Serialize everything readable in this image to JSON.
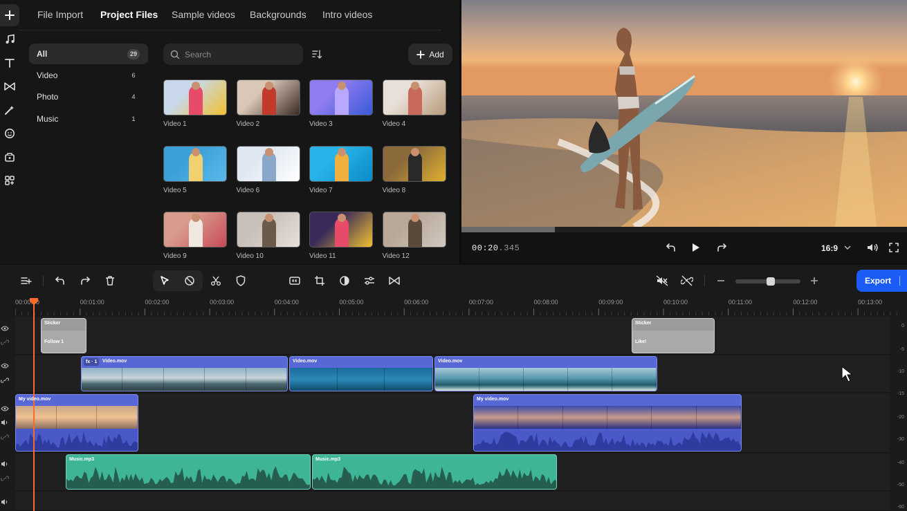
{
  "rail": [
    "plus-icon",
    "music-icon",
    "text-icon",
    "transition-icon",
    "effects-icon",
    "sticker-icon",
    "templates-icon",
    "apps-icon"
  ],
  "tabs": [
    {
      "label": "File Import",
      "active": false
    },
    {
      "label": "Project Files",
      "active": true
    },
    {
      "label": "Sample videos",
      "active": false
    },
    {
      "label": "Backgrounds",
      "active": false
    },
    {
      "label": "Intro videos",
      "active": false
    }
  ],
  "categories": [
    {
      "label": "All",
      "count": "29",
      "active": true
    },
    {
      "label": "Video",
      "count": "6",
      "active": false
    },
    {
      "label": "Photo",
      "count": "4",
      "active": false
    },
    {
      "label": "Music",
      "count": "1",
      "active": false
    }
  ],
  "search": {
    "placeholder": "Search"
  },
  "add_label": "Add",
  "media_items": [
    {
      "label": "Video 1",
      "colors": [
        "#c8d8ea",
        "#e84a6a",
        "#f0c030"
      ]
    },
    {
      "label": "Video 2",
      "colors": [
        "#d9c7b8",
        "#c43a2a",
        "#3b2a22"
      ]
    },
    {
      "label": "Video 3",
      "colors": [
        "#8e7cf0",
        "#b8a8ff",
        "#3a5ad8"
      ]
    },
    {
      "label": "Video 4",
      "colors": [
        "#e8e0d8",
        "#c86a5a",
        "#b89a7a"
      ]
    },
    {
      "label": "Video 5",
      "colors": [
        "#3aa0d8",
        "#f2d070",
        "#5ab8e8"
      ]
    },
    {
      "label": "Video 6",
      "colors": [
        "#dfe8f2",
        "#8aa6c8",
        "#ffffff"
      ]
    },
    {
      "label": "Video 7",
      "colors": [
        "#28b4e8",
        "#f0b040",
        "#0a8ac8"
      ]
    },
    {
      "label": "Video 8",
      "colors": [
        "#8a6a3a",
        "#2a2a2a",
        "#e0b030"
      ]
    },
    {
      "label": "Video 9",
      "colors": [
        "#d89a8a",
        "#f0e8e0",
        "#c84a5a"
      ]
    },
    {
      "label": "Video 10",
      "colors": [
        "#c8c0b8",
        "#6a5a4a",
        "#e8e0d8"
      ]
    },
    {
      "label": "Video 11",
      "colors": [
        "#3a2a5a",
        "#e84a6a",
        "#f0c030"
      ]
    },
    {
      "label": "Video 12",
      "colors": [
        "#b8a898",
        "#5a4a3a",
        "#d0c8c0"
      ]
    }
  ],
  "preview": {
    "time_main": "00:20",
    "time_ms": ".345",
    "ratio": "16:9",
    "progress": 0.21
  },
  "toolbar": {
    "export_label": "Export",
    "zoom_level": 0.55
  },
  "ruler": [
    "00:00:00",
    "00:01:00",
    "00:02:00",
    "00:03:00",
    "00:04:00",
    "00:05:00",
    "00:06:00",
    "00:07:00",
    "00:08:00",
    "00:09:00",
    "00:10:00",
    "00:11:00",
    "00:12:00",
    "00:13:00"
  ],
  "tracks": {
    "stickers": [
      {
        "title": "Sticker",
        "subtitle": "Follow 1"
      },
      {
        "title": "Sticker",
        "subtitle": "Like!"
      }
    ],
    "overlay_video": [
      {
        "name": "Video.mov",
        "fx": "fx · 1"
      },
      {
        "name": "Video.mov",
        "fx": ""
      },
      {
        "name": "Video.mov",
        "fx": ""
      }
    ],
    "main_video": [
      {
        "name": "My video.mov"
      },
      {
        "name": "My video.mov"
      }
    ],
    "music": [
      {
        "name": "Music.mp3"
      },
      {
        "name": "Music.mp3"
      }
    ]
  },
  "level_scale": [
    "0",
    "-5",
    "-10",
    "-15",
    "-20",
    "-30",
    "-40",
    "-50",
    "-60"
  ],
  "colors": {
    "accent": "#1a5cf5",
    "playhead": "#ff6a2a",
    "video_clip": "#5867d6",
    "audio_clip": "#3fb597"
  }
}
